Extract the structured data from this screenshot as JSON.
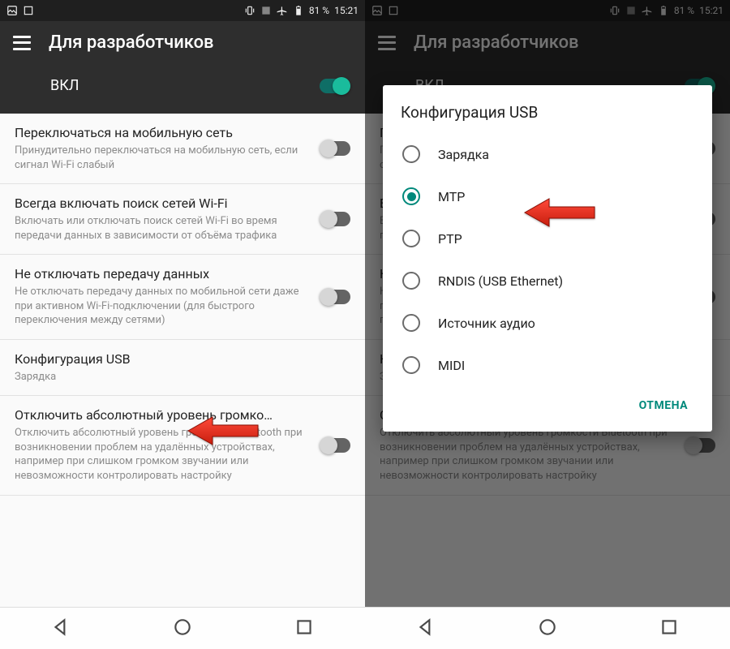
{
  "statusbar": {
    "battery": "81 %",
    "time": "15:21"
  },
  "appbar": {
    "title": "Для разработчиков",
    "master_label": "ВКЛ"
  },
  "settings": [
    {
      "title": "Переключаться на мобильную сеть",
      "sub": "Принудительно переключаться на мобильную сеть, если сигнал Wi-Fi слабый",
      "toggle": "off"
    },
    {
      "title": "Всегда включать поиск сетей Wi-Fi",
      "sub": "Включать или отключать поиск сетей Wi-Fi во время передачи данных в зависимости от объёма трафика",
      "toggle": "off"
    },
    {
      "title": "Не отключать передачу данных",
      "sub": "Не отключать передачу данных по мобильной сети даже при активном Wi-Fi-подключении (для быстрого переключения между сетями)",
      "toggle": "off"
    },
    {
      "title": "Конфигурация USB",
      "sub": "Зарядка",
      "toggle": null
    },
    {
      "title": "Отключить абсолютный уровень громко…",
      "sub": "Отключить абсолютный уровень громкости Bluetooth при возникновении проблем на удалённых устройствах, например при слишком громком звучании или невозможности контролировать настройку",
      "toggle": "off"
    }
  ],
  "dialog": {
    "title": "Конфигурация USB",
    "options": [
      "Зарядка",
      "MTP",
      "PTP",
      "RNDIS (USB Ethernet)",
      "Источник аудио",
      "MIDI"
    ],
    "selected": 1,
    "cancel": "ОТМЕНА"
  }
}
